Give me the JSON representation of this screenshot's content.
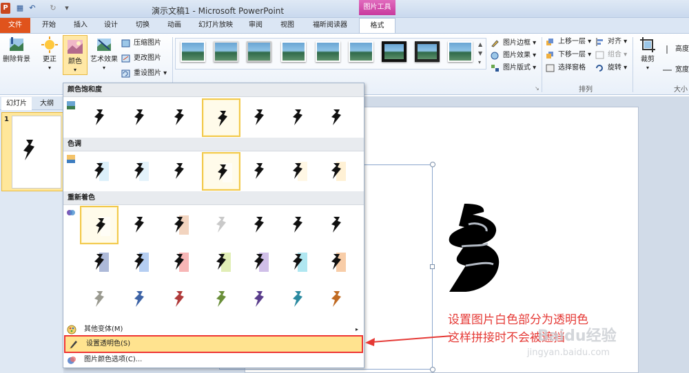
{
  "title_bar": {
    "app_icon": "P",
    "doc_title": "演示文稿1 - Microsoft PowerPoint",
    "context_group": "图片工具"
  },
  "tabs": [
    "文件",
    "开始",
    "插入",
    "设计",
    "切换",
    "动画",
    "幻灯片放映",
    "审阅",
    "视图",
    "福昕阅读器",
    "格式"
  ],
  "ribbon": {
    "remove_bg": "删除背景",
    "corrections": "更正",
    "color": "颜色",
    "artistic": "艺术效果",
    "compress": "压缩图片",
    "change": "更改图片",
    "reset": "重设图片",
    "border": "图片边框",
    "effects": "图片效果",
    "layout": "图片版式",
    "bring_forward": "上移一层",
    "send_backward": "下移一层",
    "selection_pane": "选择窗格",
    "align": "对齐",
    "group": "组合",
    "rotate": "旋转",
    "arrange_label": "排列",
    "crop": "裁剪",
    "height": "高度",
    "width": "宽度",
    "size_label": "大小"
  },
  "left_panel": {
    "tab_slides": "幻灯片",
    "tab_outline": "大纲",
    "slide_number": "1"
  },
  "dropdown": {
    "section_saturation": "颜色饱和度",
    "section_tone": "色调",
    "section_recolor": "重新着色",
    "more_variations": "其他变体(M)",
    "set_transparent": "设置透明色(S)",
    "color_options": "图片颜色选项(C)...",
    "recolor_tints": [
      "#6a7fb8",
      "#79a6e8",
      "#f07a7a",
      "#c8e07a",
      "#a98bd6",
      "#6fd4e6",
      "#f2a460"
    ],
    "recolor_dark": [
      "#9a9a90",
      "#3d63a6",
      "#b03a3a",
      "#6a8f3a",
      "#5a3d8c",
      "#2b8aa0",
      "#c06a22"
    ]
  },
  "annotation": {
    "line1": "设置图片白色部分为透明色",
    "line2": "这样拼接时不会被遮挡"
  },
  "watermark": {
    "text": "Baidu经验",
    "url": "jingyan.baidu.com"
  }
}
